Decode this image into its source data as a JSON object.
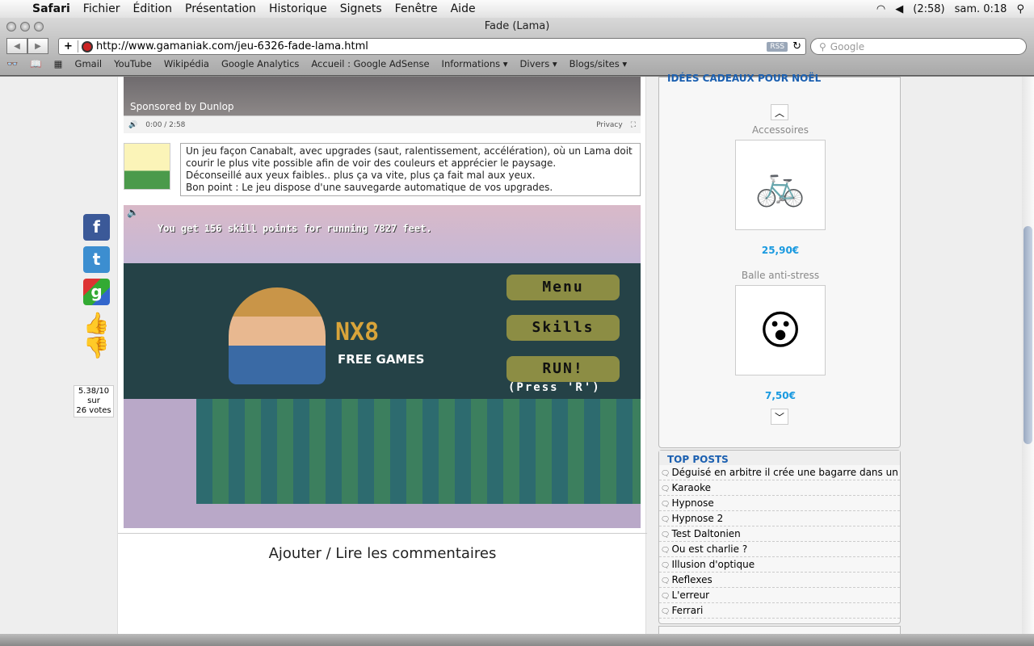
{
  "menubar": {
    "app": "Safari",
    "items": [
      "Fichier",
      "Édition",
      "Présentation",
      "Historique",
      "Signets",
      "Fenêtre",
      "Aide"
    ],
    "battery": "(2:58)",
    "clock": "sam. 0:18"
  },
  "window": {
    "title": "Fade (Lama)"
  },
  "toolbar": {
    "url": "http://www.gamaniak.com/jeu-6326-fade-lama.html",
    "rss": "RSS",
    "search_placeholder": "Google"
  },
  "bookmarks": [
    "Gmail",
    "YouTube",
    "Wikipédia",
    "Google Analytics",
    "Accueil : Google AdSense",
    "Informations ▾",
    "Divers ▾",
    "Blogs/sites ▾"
  ],
  "video": {
    "sponsor": "Sponsored by Dunlop",
    "time": "0:00 / 2:58",
    "privacy": "Privacy"
  },
  "description": [
    "Un jeu façon Canabalt, avec upgrades (saut, ralentissement, accélération), où un Lama doit courir le plus vite possible afin de voir des couleurs et apprécier le paysage.",
    "Déconseillé aux yeux faibles.. plus ça va vite, plus ça fait mal aux yeux.",
    "Bon point : Le jeu dispose d'une sauvegarde automatique de vos upgrades."
  ],
  "game": {
    "message": "You get 156 skill points for running 7827 feet.",
    "menu": "Menu",
    "skills": "Skills",
    "run": "RUN!",
    "press": "(Press 'R')",
    "brand": "NX8",
    "brand_sub": "FREE GAMES"
  },
  "social": {
    "facebook": "f",
    "twitter": "t",
    "google": "g"
  },
  "rating": {
    "score": "5.38/10",
    "sur": "sur",
    "votes": "26 votes"
  },
  "comments": "Ajouter / Lire les commentaires",
  "sidebar": {
    "gifts_title": "IDÉES CADEAUX POUR NOËL",
    "products": [
      {
        "name": "Accessoires",
        "price": "25,90€"
      },
      {
        "name": "Balle anti-stress",
        "price": "7,50€"
      }
    ],
    "top_posts_title": "TOP POSTS",
    "top_posts": [
      "Déguisé en arbitre il crée une bagarre dans un",
      "Karaoke",
      "Hypnose",
      "Hypnose 2",
      "Test Daltonien",
      "Ou est charlie ?",
      "Illusion d'optique",
      "Reflexes",
      "L'erreur",
      "Ferrari"
    ]
  }
}
